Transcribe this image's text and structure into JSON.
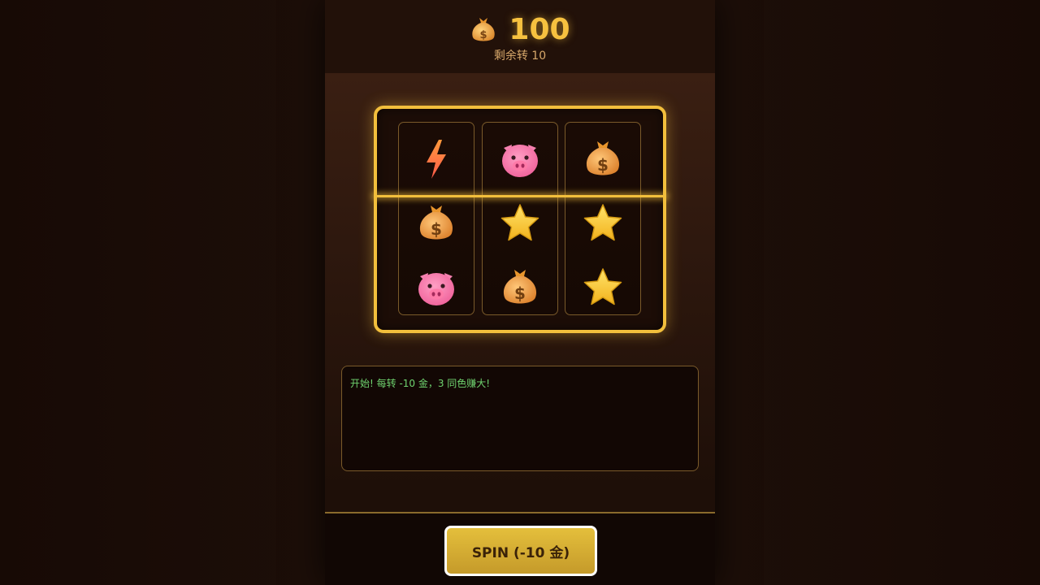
{
  "header": {
    "coins": "100",
    "coin_icon": "money-bag-icon",
    "spins_text": "剩余转 10"
  },
  "reels": [
    [
      "lightning-icon",
      "money-bag-icon",
      "pig-icon"
    ],
    [
      "pig-icon",
      "star-icon",
      "money-bag-icon"
    ],
    [
      "money-bag-icon",
      "star-icon",
      "star-icon"
    ]
  ],
  "log": {
    "lines": [
      "开始! 每转 -10 金，3 同色赚大!"
    ]
  },
  "spin_button": {
    "label": "SPIN (-10 金)"
  },
  "colors": {
    "gold": "#f2bf3c",
    "log_text": "#6fd36f"
  }
}
